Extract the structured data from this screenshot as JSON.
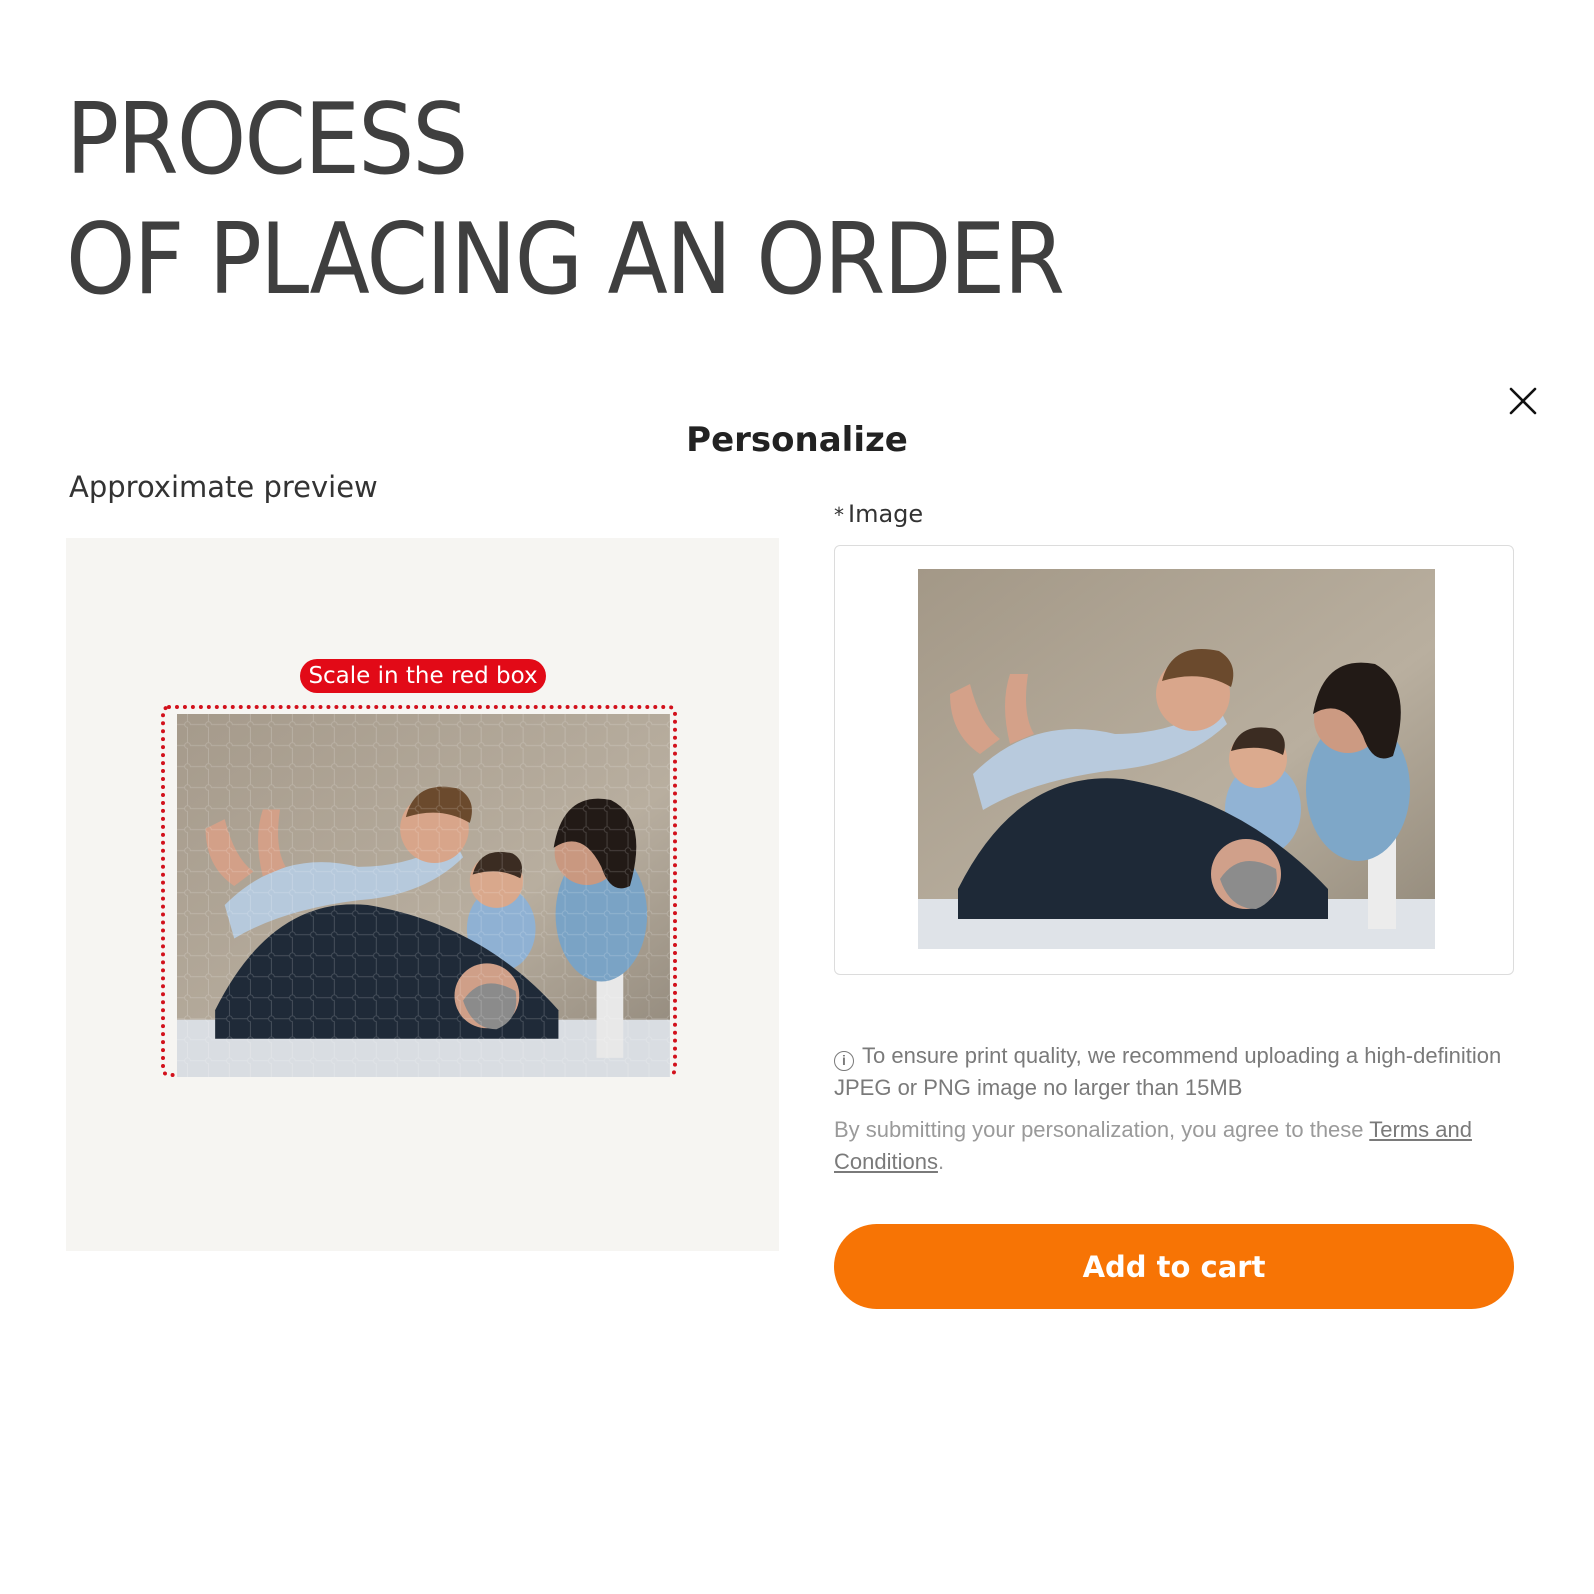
{
  "headline": {
    "line1": "PROCESS",
    "line2": "OF PLACING AN ORDER"
  },
  "modal": {
    "title": "Personalize",
    "close_icon": "close-icon"
  },
  "preview": {
    "label": "Approximate preview",
    "badge": "Scale in the red box",
    "badge_color": "#e20a17",
    "frame_color": "#d2111c",
    "panel_color": "#f6f5f2"
  },
  "image_field": {
    "required_mark": "*",
    "label": "Image"
  },
  "notice": {
    "info_icon": "info-icon",
    "quality_text": "To ensure print quality, we recommend uploading a high-definition JPEG or PNG image no larger than 15MB",
    "terms_prefix": "By submitting your personalization, you agree to these ",
    "terms_link": "Terms and Conditions",
    "terms_suffix": "."
  },
  "actions": {
    "add_to_cart": "Add to cart",
    "button_color": "#f77405"
  }
}
